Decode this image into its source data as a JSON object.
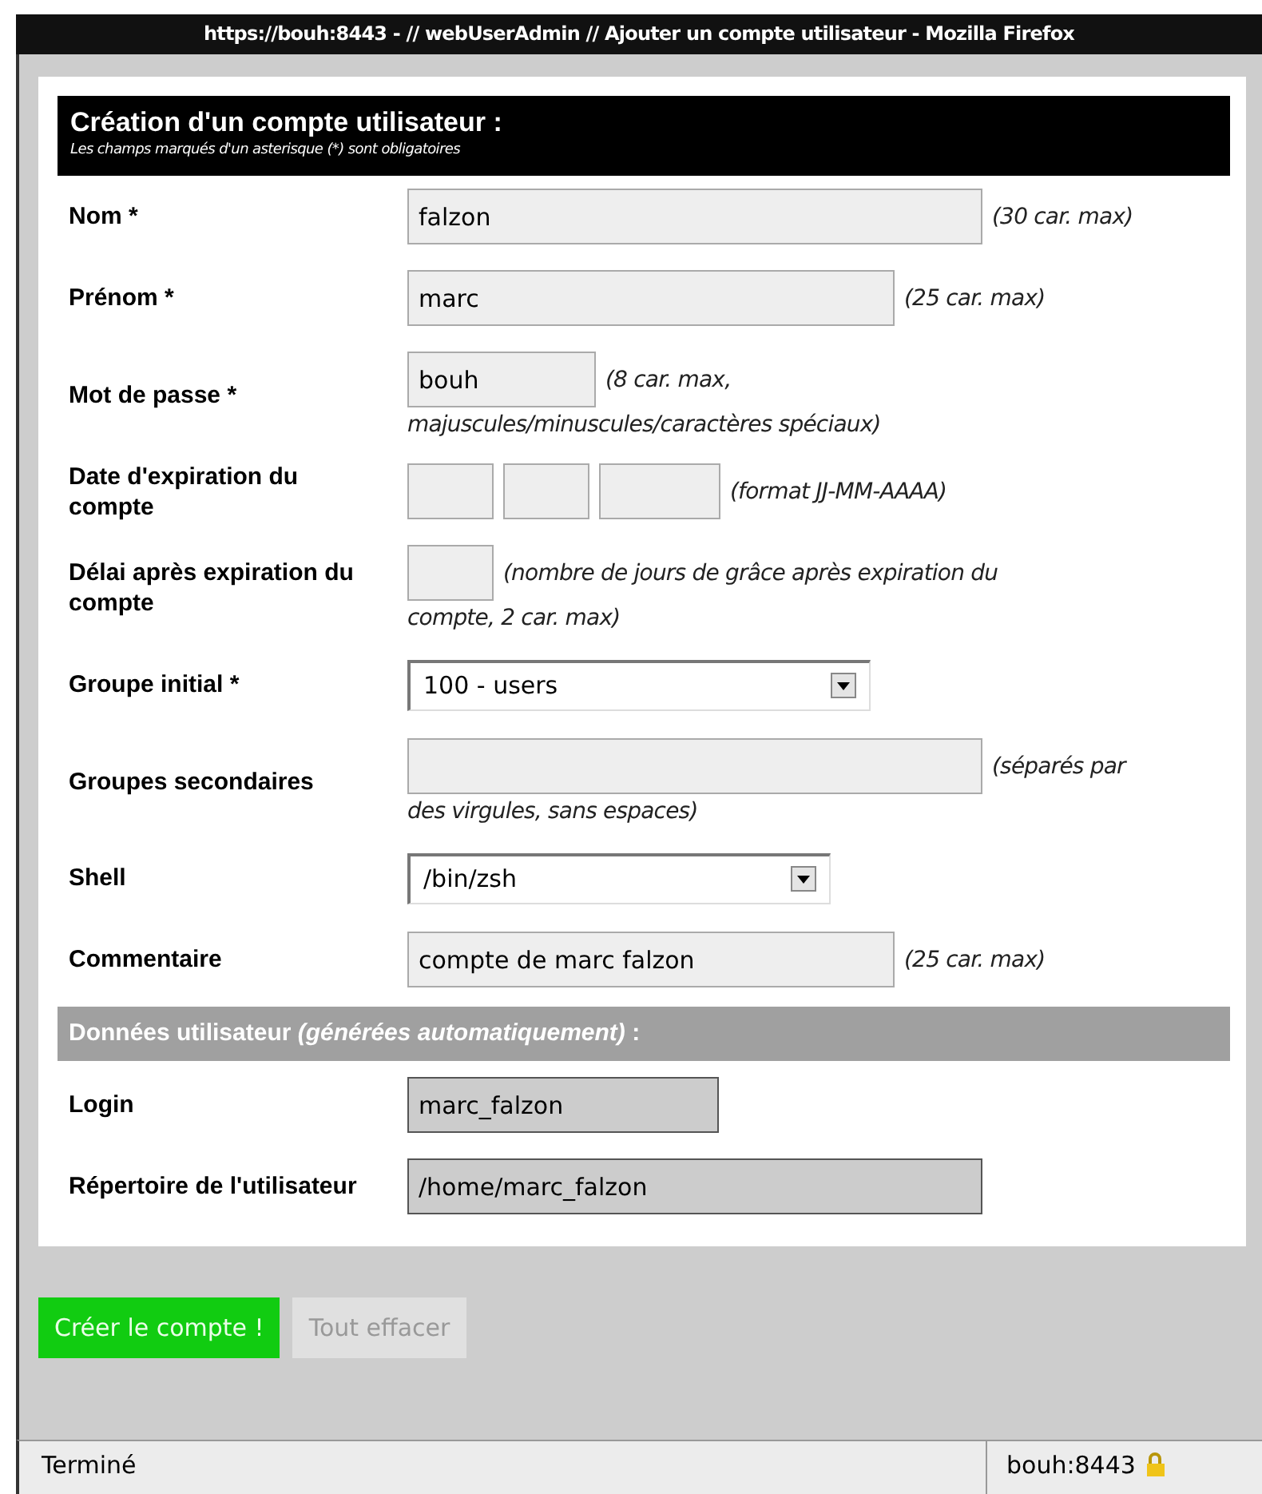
{
  "window": {
    "title": "https://bouh:8443 - // webUserAdmin // Ajouter un compte utilisateur - Mozilla Firefox"
  },
  "form": {
    "title": "Création d'un compte utilisateur :",
    "subtitle": "Les champs marqués d'un asterisque (*) sont obligatoires",
    "rows": [
      {
        "kind": "text",
        "label": "Nom *",
        "value": "falzon",
        "hint": "(30 car. max)"
      },
      {
        "kind": "text",
        "label": "Prénom *",
        "value": "marc",
        "hint": "(25 car. max)"
      },
      {
        "kind": "text",
        "label": "Mot de passe *",
        "value": "bouh",
        "hint": "(8 car. max,",
        "hint_continued": "majuscules/minuscules/caractères spéciaux)"
      },
      {
        "kind": "date",
        "label": "Date d'expiration du compte",
        "hint": "(format JJ-MM-AAAA)"
      },
      {
        "kind": "text",
        "label": "Délai après expiration du compte",
        "hint": "(nombre de jours de grâce après expiration du",
        "hint_continued": "compte, 2 car. max)"
      },
      {
        "kind": "select",
        "label": "Groupe initial *",
        "value": "100 - users"
      },
      {
        "kind": "text",
        "label": "Groupes secondaires",
        "hint": "(séparés par",
        "hint_continued": "des virgules, sans espaces)"
      },
      {
        "kind": "select",
        "label": "Shell",
        "value": "/bin/zsh"
      },
      {
        "kind": "text",
        "label": "Commentaire",
        "value": "compte de marc falzon",
        "hint": "(25 car. max)"
      },
      {
        "kind": "section",
        "label": "Données utilisateur *(générées automatiquement)* :"
      },
      {
        "kind": "readonly",
        "label": "Login",
        "value": "marc_falzon"
      },
      {
        "kind": "readonly",
        "label": "Répertoire de l'utilisateur",
        "value": "/home/marc_falzon"
      }
    ]
  },
  "buttons": [
    {
      "label": "Créer le compte !",
      "kind": "primary"
    },
    {
      "label": "Tout effacer",
      "kind": "secondary"
    }
  ],
  "status_bar": {
    "text": "Terminé",
    "host": "bouh:8443"
  }
}
